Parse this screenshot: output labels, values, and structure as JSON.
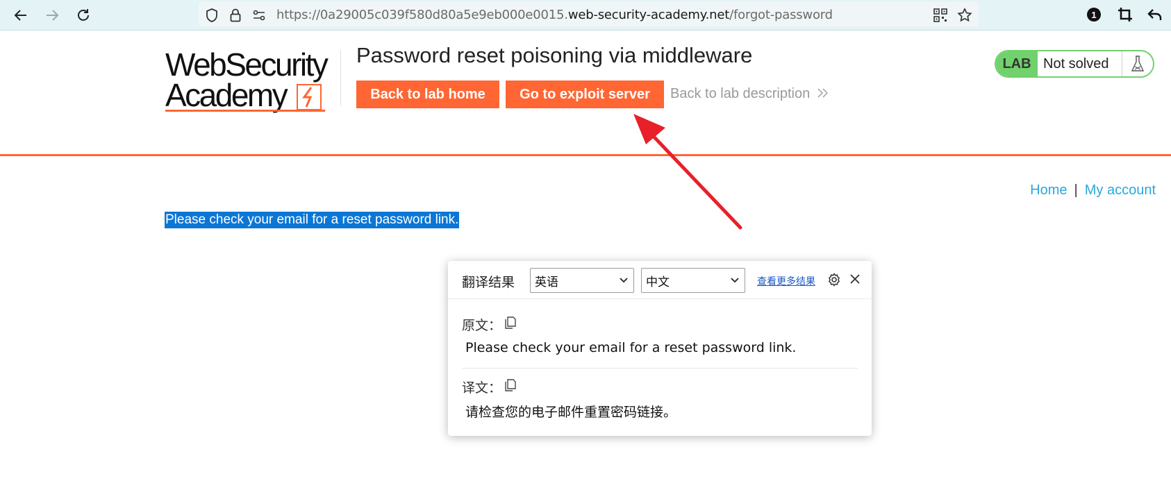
{
  "browser": {
    "url_prefix": "https://0a29005c039f580d80a5e9eb000e0015.",
    "url_host": "web-security-academy.net",
    "url_path": "/forgot-password",
    "ext_badge": "1"
  },
  "logo": {
    "line1": "WebSecurity",
    "line2": "Academy"
  },
  "lab": {
    "title": "Password reset poisoning via middleware",
    "back_home": "Back to lab home",
    "exploit_server": "Go to exploit server",
    "back_description": "Back to lab description",
    "badge": "LAB",
    "status": "Not solved"
  },
  "nav": {
    "home": "Home",
    "separator": "|",
    "account": "My account"
  },
  "message": "Please check your email for a reset password link.",
  "translator": {
    "title": "翻译结果",
    "source_lang": "英语",
    "target_lang": "中文",
    "more_results": "查看更多结果",
    "original_label": "原文：",
    "original_text": "Please check your email for a reset password link.",
    "translation_label": "译文：",
    "translation_text": "请检查您的电子邮件重置密码链接。"
  },
  "colors": {
    "accent_orange": "#ff6633",
    "lab_green": "#70d16d",
    "link_blue": "#29a8dc",
    "selection_blue": "#0b76d6",
    "arrow_red": "#e8202a"
  }
}
